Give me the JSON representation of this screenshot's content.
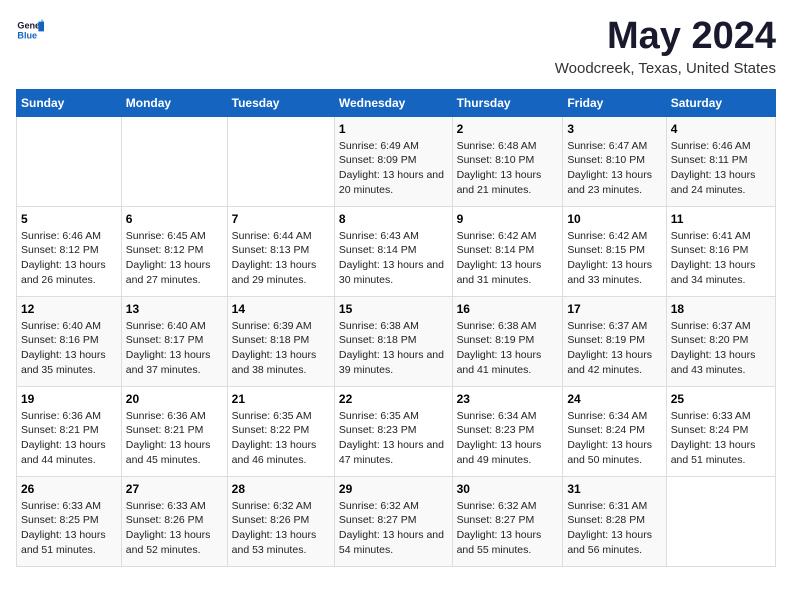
{
  "logo": {
    "text_general": "General",
    "text_blue": "Blue",
    "tagline": "GeneralBlue"
  },
  "title": "May 2024",
  "subtitle": "Woodcreek, Texas, United States",
  "days_of_week": [
    "Sunday",
    "Monday",
    "Tuesday",
    "Wednesday",
    "Thursday",
    "Friday",
    "Saturday"
  ],
  "weeks": [
    [
      {
        "day": "",
        "info": ""
      },
      {
        "day": "",
        "info": ""
      },
      {
        "day": "",
        "info": ""
      },
      {
        "day": "1",
        "info": "Sunrise: 6:49 AM\nSunset: 8:09 PM\nDaylight: 13 hours and 20 minutes."
      },
      {
        "day": "2",
        "info": "Sunrise: 6:48 AM\nSunset: 8:10 PM\nDaylight: 13 hours and 21 minutes."
      },
      {
        "day": "3",
        "info": "Sunrise: 6:47 AM\nSunset: 8:10 PM\nDaylight: 13 hours and 23 minutes."
      },
      {
        "day": "4",
        "info": "Sunrise: 6:46 AM\nSunset: 8:11 PM\nDaylight: 13 hours and 24 minutes."
      }
    ],
    [
      {
        "day": "5",
        "info": "Sunrise: 6:46 AM\nSunset: 8:12 PM\nDaylight: 13 hours and 26 minutes."
      },
      {
        "day": "6",
        "info": "Sunrise: 6:45 AM\nSunset: 8:12 PM\nDaylight: 13 hours and 27 minutes."
      },
      {
        "day": "7",
        "info": "Sunrise: 6:44 AM\nSunset: 8:13 PM\nDaylight: 13 hours and 29 minutes."
      },
      {
        "day": "8",
        "info": "Sunrise: 6:43 AM\nSunset: 8:14 PM\nDaylight: 13 hours and 30 minutes."
      },
      {
        "day": "9",
        "info": "Sunrise: 6:42 AM\nSunset: 8:14 PM\nDaylight: 13 hours and 31 minutes."
      },
      {
        "day": "10",
        "info": "Sunrise: 6:42 AM\nSunset: 8:15 PM\nDaylight: 13 hours and 33 minutes."
      },
      {
        "day": "11",
        "info": "Sunrise: 6:41 AM\nSunset: 8:16 PM\nDaylight: 13 hours and 34 minutes."
      }
    ],
    [
      {
        "day": "12",
        "info": "Sunrise: 6:40 AM\nSunset: 8:16 PM\nDaylight: 13 hours and 35 minutes."
      },
      {
        "day": "13",
        "info": "Sunrise: 6:40 AM\nSunset: 8:17 PM\nDaylight: 13 hours and 37 minutes."
      },
      {
        "day": "14",
        "info": "Sunrise: 6:39 AM\nSunset: 8:18 PM\nDaylight: 13 hours and 38 minutes."
      },
      {
        "day": "15",
        "info": "Sunrise: 6:38 AM\nSunset: 8:18 PM\nDaylight: 13 hours and 39 minutes."
      },
      {
        "day": "16",
        "info": "Sunrise: 6:38 AM\nSunset: 8:19 PM\nDaylight: 13 hours and 41 minutes."
      },
      {
        "day": "17",
        "info": "Sunrise: 6:37 AM\nSunset: 8:19 PM\nDaylight: 13 hours and 42 minutes."
      },
      {
        "day": "18",
        "info": "Sunrise: 6:37 AM\nSunset: 8:20 PM\nDaylight: 13 hours and 43 minutes."
      }
    ],
    [
      {
        "day": "19",
        "info": "Sunrise: 6:36 AM\nSunset: 8:21 PM\nDaylight: 13 hours and 44 minutes."
      },
      {
        "day": "20",
        "info": "Sunrise: 6:36 AM\nSunset: 8:21 PM\nDaylight: 13 hours and 45 minutes."
      },
      {
        "day": "21",
        "info": "Sunrise: 6:35 AM\nSunset: 8:22 PM\nDaylight: 13 hours and 46 minutes."
      },
      {
        "day": "22",
        "info": "Sunrise: 6:35 AM\nSunset: 8:23 PM\nDaylight: 13 hours and 47 minutes."
      },
      {
        "day": "23",
        "info": "Sunrise: 6:34 AM\nSunset: 8:23 PM\nDaylight: 13 hours and 49 minutes."
      },
      {
        "day": "24",
        "info": "Sunrise: 6:34 AM\nSunset: 8:24 PM\nDaylight: 13 hours and 50 minutes."
      },
      {
        "day": "25",
        "info": "Sunrise: 6:33 AM\nSunset: 8:24 PM\nDaylight: 13 hours and 51 minutes."
      }
    ],
    [
      {
        "day": "26",
        "info": "Sunrise: 6:33 AM\nSunset: 8:25 PM\nDaylight: 13 hours and 51 minutes."
      },
      {
        "day": "27",
        "info": "Sunrise: 6:33 AM\nSunset: 8:26 PM\nDaylight: 13 hours and 52 minutes."
      },
      {
        "day": "28",
        "info": "Sunrise: 6:32 AM\nSunset: 8:26 PM\nDaylight: 13 hours and 53 minutes."
      },
      {
        "day": "29",
        "info": "Sunrise: 6:32 AM\nSunset: 8:27 PM\nDaylight: 13 hours and 54 minutes."
      },
      {
        "day": "30",
        "info": "Sunrise: 6:32 AM\nSunset: 8:27 PM\nDaylight: 13 hours and 55 minutes."
      },
      {
        "day": "31",
        "info": "Sunrise: 6:31 AM\nSunset: 8:28 PM\nDaylight: 13 hours and 56 minutes."
      },
      {
        "day": "",
        "info": ""
      }
    ]
  ]
}
